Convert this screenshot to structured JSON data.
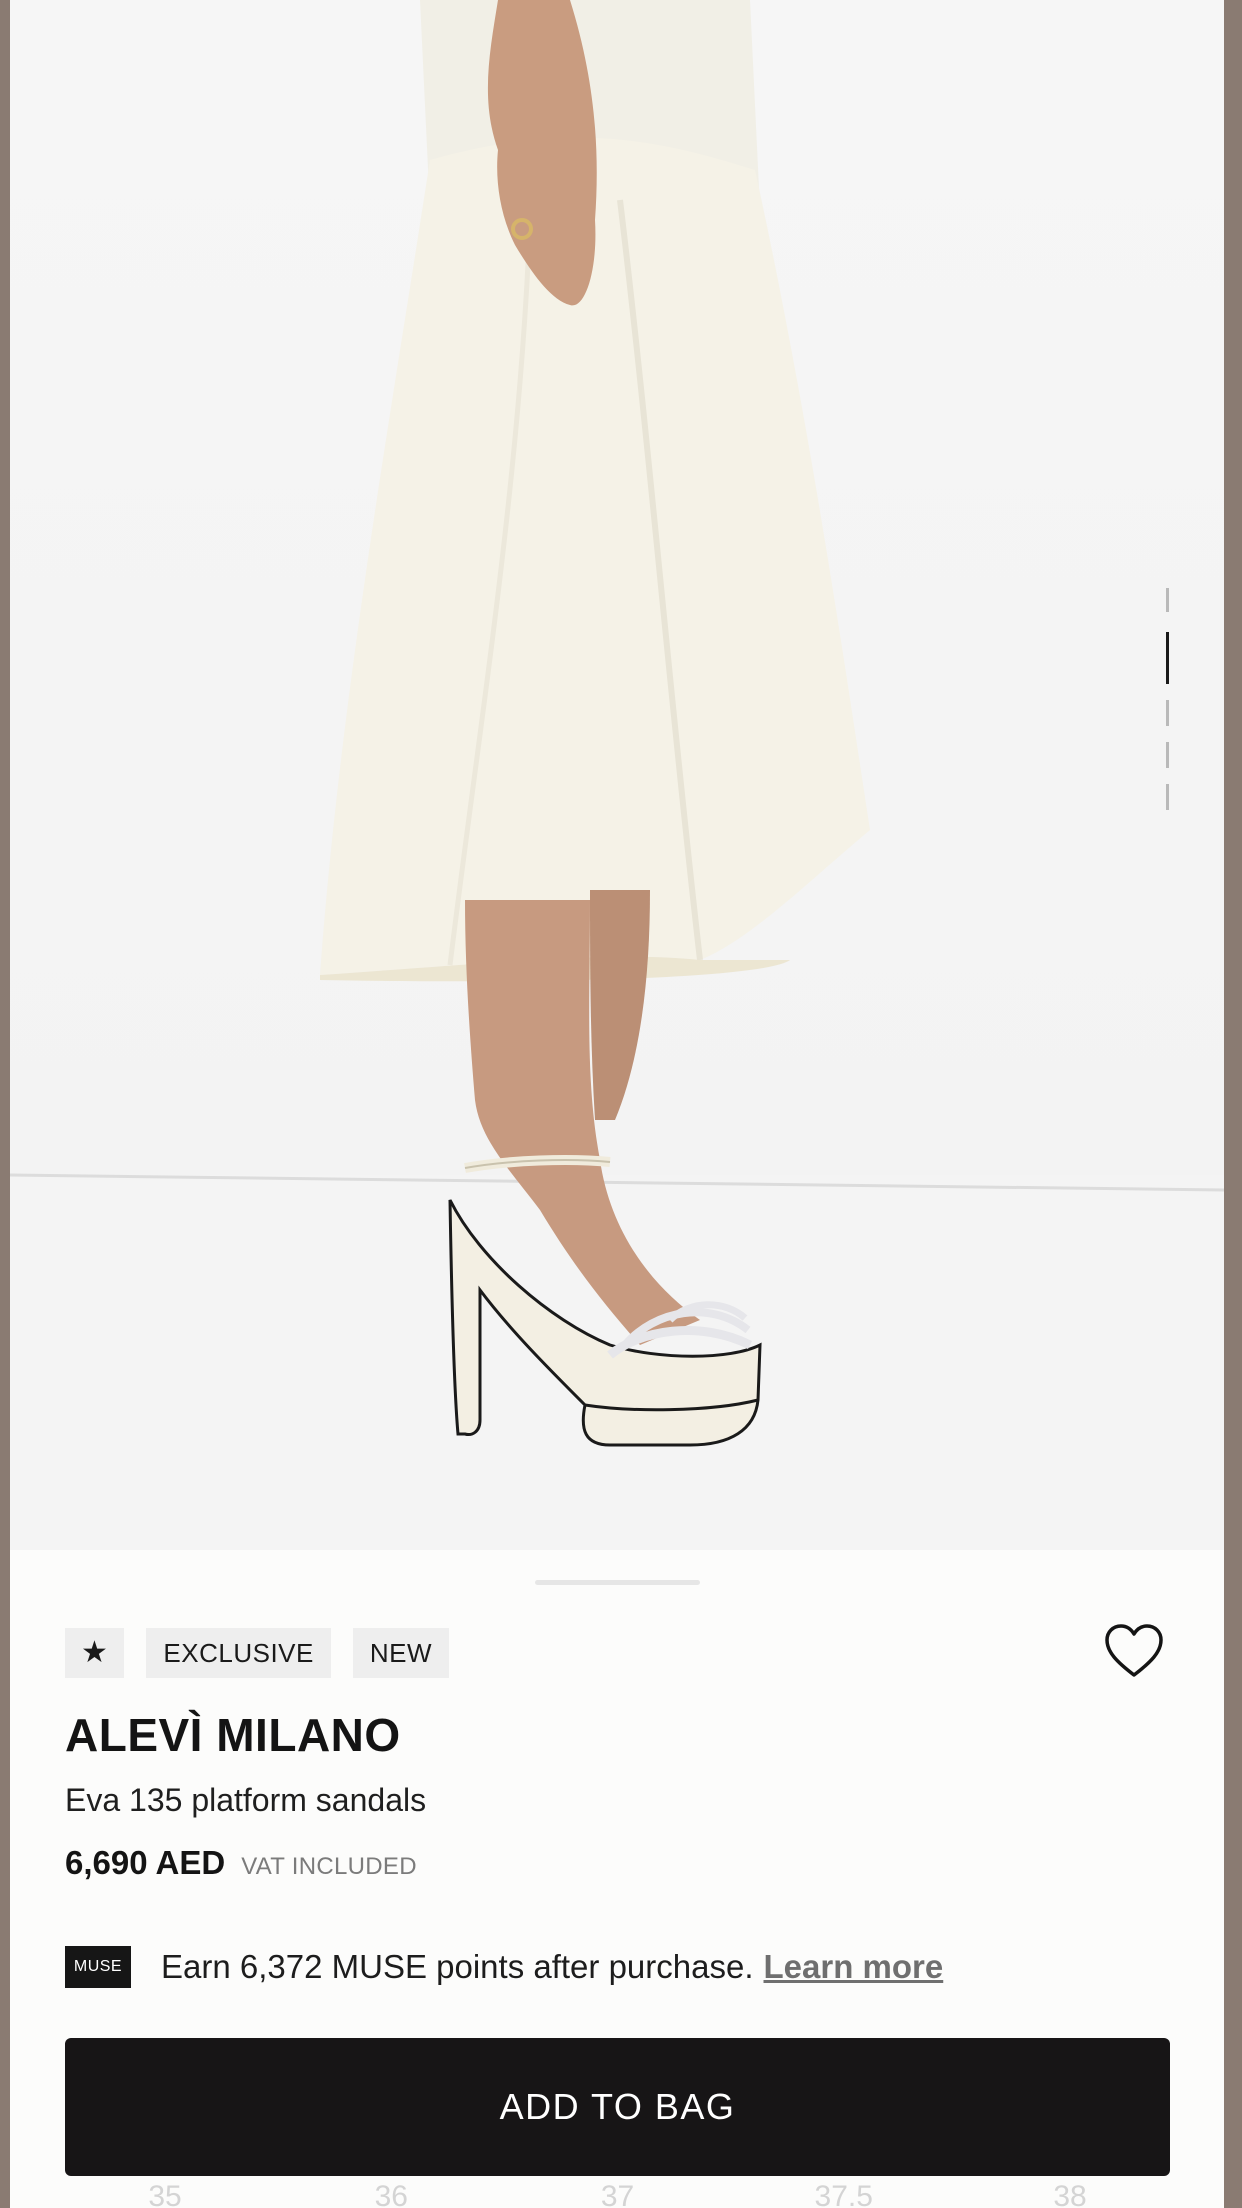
{
  "badges": {
    "star": "★",
    "exclusive": "EXCLUSIVE",
    "new": "NEW"
  },
  "product": {
    "brand": "ALEVÌ MILANO",
    "name": "Eva 135 platform sandals",
    "price": "6,690 AED",
    "vat": "VAT INCLUDED"
  },
  "muse": {
    "logo": "MUSE",
    "text": "Earn 6,372 MUSE points after purchase.",
    "link": "Learn more"
  },
  "cta": {
    "add_to_bag": "ADD TO BAG"
  },
  "sizes": [
    "35",
    "36",
    "37",
    "37.5",
    "38"
  ],
  "gallery": {
    "pages": 5,
    "active_index": 1
  },
  "icons": {
    "wishlist": "heart-icon",
    "muse": "muse-logo-icon"
  },
  "colors": {
    "button": "#171516",
    "badge_bg": "#eeeeee",
    "link": "#6f6f6f"
  }
}
